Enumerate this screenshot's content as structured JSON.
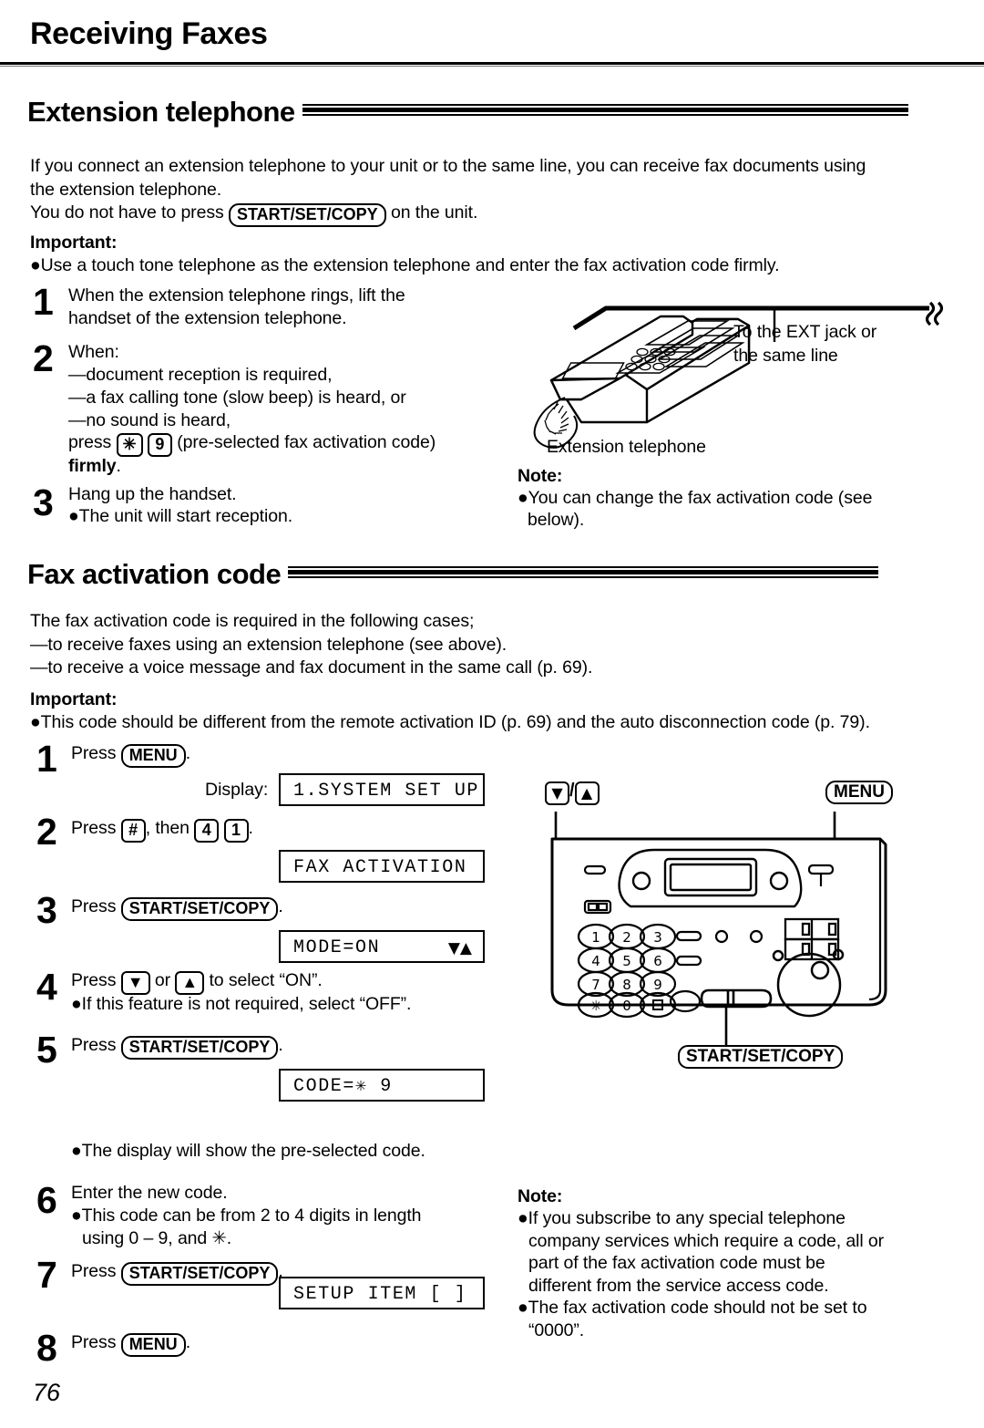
{
  "page": {
    "running_head": "Receiving Faxes",
    "folio": "76"
  },
  "section_ext": {
    "title": "Extension telephone",
    "intro_line1": "If you connect an extension telephone to your unit or to the same line, you can receive fax documents using",
    "intro_line2": "the extension telephone.",
    "intro_line3_pre": "You do not have to press",
    "intro_line3_key": "START/SET/COPY",
    "intro_line3_post": "on the unit.",
    "important_label": "Important:",
    "important_bullet": "●Use a touch tone telephone as the extension telephone and enter the fax activation code firmly.",
    "steps": [
      {
        "num": "1",
        "lines": [
          "When the extension telephone rings, lift the",
          "handset of the extension telephone."
        ]
      },
      {
        "num": "2",
        "lines": [
          "When:",
          "—document reception is required,",
          "—a fax calling tone (slow beep) is heard, or",
          "—no sound is heard,"
        ],
        "press_pre": "press",
        "key_star": "✳",
        "key_nine": "9",
        "press_post": "(pre-selected fax activation code)",
        "firmly": "firmly",
        "firmly_period": "."
      },
      {
        "num": "3",
        "lines": [
          "Hang up the handset.",
          "●The unit will start reception."
        ]
      }
    ]
  },
  "illustration_phone": {
    "ext_jack_label_line1": "To the EXT jack or",
    "ext_jack_label_line2": "the same line",
    "caption": "Extension telephone",
    "note_label": "Note:",
    "note_lines": [
      "●You can change the fax activation code (see",
      "below)."
    ]
  },
  "section_code": {
    "title": "Fax activation code",
    "intro_lines": [
      "The fax activation code is required in the following cases;",
      "—to receive faxes using an extension telephone (see above).",
      "—to receive a voice message and fax document in the same call (p. 69)."
    ],
    "important_label": "Important:",
    "important_bullet": "●This code should be different from the remote activation ID (p. 69) and the auto disconnection code (p. 79).",
    "steps": [
      {
        "num": "1",
        "press": "Press",
        "key": "MENU",
        "period": "."
      },
      {
        "num": "2",
        "press": "Press",
        "key1": "#",
        "mid": ", then",
        "key2": "4",
        "key3": "1",
        "period": "."
      },
      {
        "num": "3",
        "press": "Press",
        "key": "START/SET/COPY",
        "period": "."
      },
      {
        "num": "4",
        "press": "Press",
        "key1": "▼",
        "mid": "or",
        "key2": "▲",
        "post": "to select “ON”.",
        "bullet": "●If this feature is not required, select “OFF”."
      },
      {
        "num": "5",
        "press": "Press",
        "key": "START/SET/COPY",
        "period": ".",
        "bullet": "●The display will show the pre-selected code."
      },
      {
        "num": "6",
        "lines": [
          "Enter the new code.",
          "●This code can be from 2 to 4 digits in length",
          "using 0 – 9, and ✳."
        ]
      },
      {
        "num": "7",
        "press": "Press",
        "key": "START/SET/COPY",
        "period": "."
      },
      {
        "num": "8",
        "press": "Press",
        "key": "MENU",
        "period": "."
      }
    ],
    "display_label": "Display:",
    "displays": {
      "d1": "1.SYSTEM SET UP",
      "d2": "FAX ACTIVATION",
      "d3": "MODE=ON",
      "d3_arrows": "▼▲",
      "d5": "CODE=✳ 9",
      "d7": "SETUP ITEM [    ]"
    }
  },
  "illustration_panel": {
    "callout_down": "▼",
    "callout_slash": "/",
    "callout_up": "▲",
    "callout_menu": "MENU",
    "callout_start": "START/SET/COPY",
    "keypad": [
      "1",
      "2",
      "3",
      "4",
      "5",
      "6",
      "7",
      "8",
      "9",
      "✳",
      "0",
      "□"
    ]
  },
  "note_bottom": {
    "label": "Note:",
    "lines": [
      "●If you subscribe to any special telephone",
      "company services which require a code, all or",
      "part of the fax activation code must be",
      "different from the service access code.",
      "●The fax activation code should not be set to",
      "“0000”."
    ]
  },
  "colors": {
    "ink": "#000000",
    "paper": "#ffffff"
  }
}
